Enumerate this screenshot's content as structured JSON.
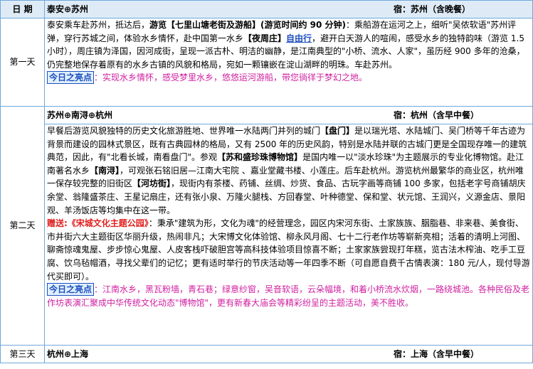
{
  "header": {
    "col1": "日 期",
    "route": "泰安⊕苏州",
    "stay": "宿：苏州（含晚餐）"
  },
  "day1": {
    "label": "第一天",
    "p1": "泰安乘车赴苏州，抵达后，",
    "p1_bold": "游览【七里山塘老街及游船】(游览时间约 90 分钟)",
    "p1b": "：乘船游在运河之上，细听\"吴侬软语\"苏州评弹，穿行苏城之间，体验水乡情怀，赴中国第一水乡",
    "p1_zhouzhuang": "【夜周庄】",
    "p1_free": "自由行",
    "p1c": "，避开白天游人的喧闹，感受水乡的独特韵味（游览 1.5 小时），周庄镇为泽国，因河成街，呈现一派古朴、明洁的幽静，是江南典型的\"小桥、流水、人家\"，虽历经 900 多年的沧桑，仍完整地保存着原有的水乡古镇的风貌和格局，宛如一颗镶嵌在淀山湖畔的明珠。车赴苏州。",
    "highlight_label": "今日之亮点",
    "highlight": "：实现水乡情怀，感受梦里水乡，悠悠运河游船，带您徜徉于梦幻之地。"
  },
  "day2": {
    "label": "第二天",
    "route": "苏州⊕南浔⊕杭州",
    "stay": "宿：杭州（含早中餐）",
    "p1a": "早餐后游览风貌独特的历史文化旅游胜地、世界唯一水陆两门并列的城门",
    "p1_panmen": "【盘门】",
    "p1b": "是以瑞光塔、水陆城门、吴门桥等千年古迹为背景而建设的园林式景区，既有古典园林的格局，又有 2500 年的历史风韵，特别是水陆并联的古城门更是全国现存唯一的建筑典范，因此，有\"北看长城，南看盘门\"。参观",
    "p1_museum": "【苏和盛珍珠博物馆】",
    "p1c": "是国内唯一以\"淡水珍珠\"为主题展示的专业化博物馆。赴江南著名水乡",
    "p1_nanxun": "【南浔】",
    "p1d": "，可观张石铭旧居—江南大宅院 、嘉业堂藏书楼、小莲庄。后车赴杭州。游览杭州最繁华的商业区，杭州唯一保存较完整的旧街区",
    "p1_hefang": "【河坊街】",
    "p1e": "，现街内有茶楼、药铺、丝绸、炒货、食品、古玩字画等商铺 100 多家，包括老字号商铺胡庆余堂、翁隆盛茶庄、王星记扇庄，还有张小泉、万隆火腿栈、方回春堂、叶种德堂、保和堂、状元馆、王润兴，义源金店、景阳观、羊汤饭店等均集中在这一带。",
    "gift_label": "赠送:《宋城文化主题公园》",
    "p2": "：秉承\"建筑为形，文化为魂\"的经营理念，园区内宋河东街、土家族族、胭脂巷、非来巷、美食街、市井街六大主题街区华丽升级，热闹非凡；大宋博文化体验馆、柳永风月阁、七十二行老作坊等崭新亮相；活着的清明上河图、聊斋惊魂鬼屋、步步惊心鬼屋、人皮客栈吓破胆宫等高科技体验项目惊喜不断；土家家族尝现打年糕，览古法木榨油、吃手工豆腐、饮乌毡帽酒，寻找父辈们的记忆；更有适时举行的节庆活动等一年四季不断（可自愿自费千古情表演：180 元/人，现付导游代买即可）。",
    "highlight_label": "今日之亮点",
    "highlight": "：江南水乡，黑瓦粉墙，青石巷；绿意纱窗，吴音软语，云朵幅境，和着小桥流水炊烟，一路绕城池。各种民俗及老作坊表演汇聚成中华传统文化动态\"博物馆\"，更有新春大庙会等精彩纷呈的主题活动，美不胜收。"
  },
  "day3": {
    "label": "第三天",
    "route": "杭州⊕上海",
    "stay": "宿：上海（含早中餐）"
  }
}
